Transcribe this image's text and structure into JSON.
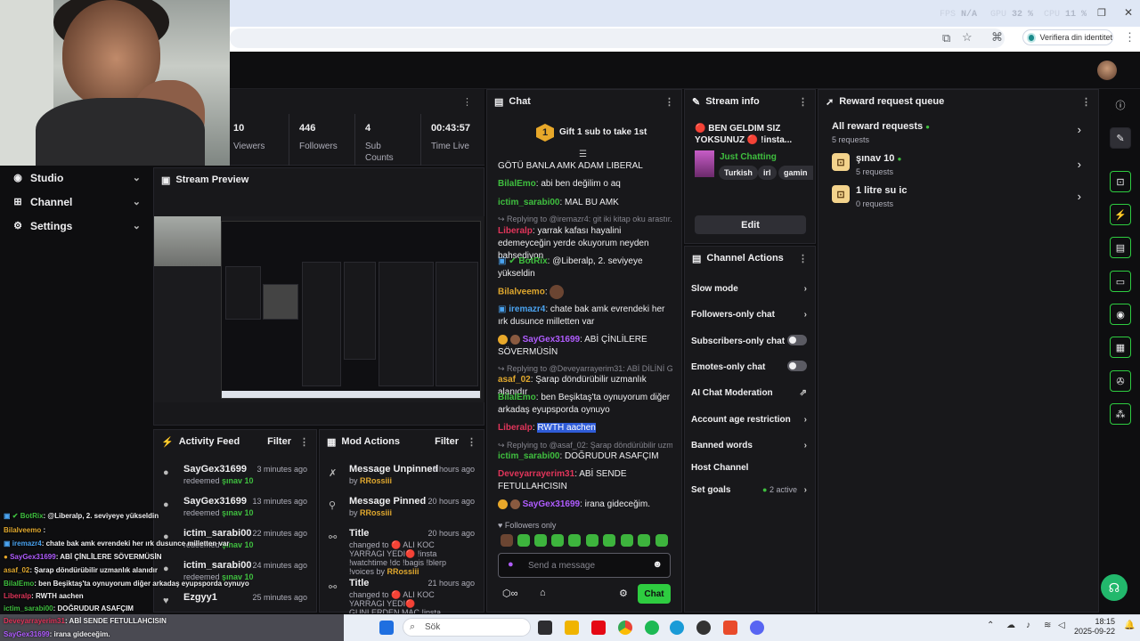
{
  "browser": {
    "stats": [
      {
        "k": "FPS",
        "v": "N/A"
      },
      {
        "k": "GPU",
        "v": "32 %"
      },
      {
        "k": "CPU",
        "v": "11 %"
      }
    ],
    "verify_label": "Verifiera din identitet"
  },
  "nav": {
    "items": [
      {
        "label": "Studio"
      },
      {
        "label": "Channel"
      },
      {
        "label": "Settings"
      }
    ]
  },
  "stats": [
    {
      "value": "10",
      "label": "Viewers"
    },
    {
      "value": "446",
      "label": "Followers"
    },
    {
      "value": "4",
      "label": "Sub Counts"
    },
    {
      "value": "00:43:57",
      "label": "Time Live"
    }
  ],
  "preview": {
    "title": "Stream Preview"
  },
  "activity": {
    "title": "Activity Feed",
    "filter": "Filter",
    "rows": [
      {
        "name": "SayGex31699",
        "prefix": "redeemed ",
        "reward": "şınav 10",
        "time": "3 minutes ago"
      },
      {
        "name": "SayGex31699",
        "prefix": "redeemed ",
        "reward": "şınav 10",
        "time": "13 minutes ago"
      },
      {
        "name": "ictim_sarabi00",
        "prefix": "redeemed ",
        "reward": "şınav 10",
        "time": "22 minutes ago"
      },
      {
        "name": "ictim_sarabi00",
        "prefix": "redeemed ",
        "reward": "şınav 10",
        "time": "24 minutes ago"
      },
      {
        "name": "Ezgyy1",
        "prefix": "",
        "reward": "",
        "time": "25 minutes ago"
      }
    ]
  },
  "mod": {
    "title": "Mod Actions",
    "filter": "Filter",
    "rows": [
      {
        "title": "Message Unpinned",
        "sub": "by ",
        "by": "RRossiii",
        "time": "8 hours ago"
      },
      {
        "title": "Message Pinned",
        "sub": "by ",
        "by": "RRossiii",
        "time": "20 hours ago"
      },
      {
        "title": "Title",
        "sub": "changed to 🔴 ALI KOC YARRAGI YEDI🔴 !insta !watchtime !dc !bagis !blerp !voices by ",
        "by": "RRossiii",
        "time": "20 hours ago"
      },
      {
        "title": "Title",
        "sub": "changed to 🔴 ALI KOC YARRAGI YEDI🔴 GUNLERDEN MAC !insta",
        "by": "",
        "time": "21 hours ago"
      }
    ]
  },
  "chat": {
    "title": "Chat",
    "gift_badge": "1",
    "gift": "Gift 1 sub to take 1st",
    "messages": [
      {
        "user": "",
        "text": "GÖTÜ BANLA AMK ADAM LIBERAL",
        "color": "#efeff1"
      },
      {
        "user": "BilalEmo",
        "text": ": abi ben değilim o aq",
        "color": "#3fbf3f"
      },
      {
        "user": "ictim_sarabi00",
        "text": ": MAL BU AMK",
        "color": "#3fbf3f"
      },
      {
        "reply": "Replying to @iremazr4: git iki kitap oku arastır..."
      },
      {
        "user": "Liberalp",
        "text": ": yarrak kafası hayalini edemeyceğin yerde okuyorum neyden bahsediyon",
        "color": "#e0355a"
      },
      {
        "user": "BotRix",
        "text": ": @Liberalp, 2. seviyeye yükseldin",
        "color": "#3fbf3f"
      },
      {
        "user": "Bilalveemo",
        "text": ":",
        "color": "#e0a82e"
      },
      {
        "user": "iremazr4",
        "text": ": chate bak amk evrendeki her ırk dusunce milletten var",
        "color": "#4aa3f0"
      },
      {
        "user": "SayGex31699",
        "text": ": ABİ ÇİNLİLERE SÖVERMÜSİN",
        "color": "#b05cff"
      },
      {
        "reply": "Replying to @Deveyarrayerim31: ABİ DİLİNİ GÖ..."
      },
      {
        "user": "asaf_02",
        "text": ": Şarap döndürübilir uzmanlık alanıdır",
        "color": "#e0a82e"
      },
      {
        "user": "BilalEmo",
        "text": ": ben Beşiktaş'ta oynuyorum diğer arkadaş eyupsporda oynuyo",
        "color": "#3fbf3f"
      },
      {
        "user": "Liberalp",
        "text": ": ",
        "highlight": "RWTH aachen",
        "color": "#e0355a"
      },
      {
        "reply": "Replying to @asaf_02: Şarap döndürübilir uzma..."
      },
      {
        "user": "ictim_sarabi00",
        "text": ": DOĞRUDUR ASAFÇIM",
        "color": "#3fbf3f"
      },
      {
        "user": "Deveyarrayerim31",
        "text": ": ABİ SENDE FETULLAHCISIN",
        "color": "#e0355a"
      },
      {
        "user": "SayGex31699",
        "text": ": irana gideceğim.",
        "color": "#b05cff"
      }
    ],
    "followers_only": "Followers only",
    "placeholder": "Send a message",
    "send": "Chat"
  },
  "stream_info": {
    "title": "Stream info",
    "stream_title": "🔴 BEN GELDIM SIZ YOKSUNUZ 🔴 !insta...",
    "category": "Just Chatting",
    "tags": [
      "Turkish",
      "irl",
      "gamin"
    ],
    "edit": "Edit"
  },
  "channel_actions": {
    "title": "Channel Actions",
    "rows": [
      {
        "label": "Slow mode",
        "kind": "chev"
      },
      {
        "label": "Followers-only chat",
        "kind": "chev"
      },
      {
        "label": "Subscribers-only chat",
        "kind": "toggle"
      },
      {
        "label": "Emotes-only chat",
        "kind": "toggle"
      },
      {
        "label": "AI Chat Moderation",
        "kind": "ext"
      },
      {
        "label": "Account age restriction",
        "kind": "chev"
      },
      {
        "label": "Banned words",
        "kind": "chev"
      },
      {
        "label": "Host Channel",
        "kind": "none"
      },
      {
        "label": "Set goals",
        "kind": "goals",
        "extra": "2 active"
      }
    ]
  },
  "rewards": {
    "title": "Reward request queue",
    "all_title": "All reward requests",
    "all_count": "5 requests",
    "items": [
      {
        "title": "şınav 10",
        "count": "5 requests"
      },
      {
        "title": "1 litre su ic",
        "count": "0 requests"
      }
    ]
  },
  "overlay": [
    {
      "user": "BotRix",
      "text": ": @Liberalp, 2. seviyeye yükseldin",
      "color": "#3fbf3f"
    },
    {
      "user": "Bilalveemo",
      "text": " :",
      "color": "#e0a82e"
    },
    {
      "user": "iremazr4",
      "text": ": chate bak amk evrendeki her ırk dusunce milletten var",
      "color": "#4aa3f0"
    },
    {
      "user": "SayGex31699",
      "text": ": ABİ ÇİNLİLERE SÖVERMÜSİN",
      "color": "#b05cff"
    },
    {
      "user": "asaf_02",
      "text": ": Şarap döndürübilir uzmanlık alanıdır",
      "color": "#e0a82e"
    },
    {
      "user": "BilalEmo",
      "text": ": ben Beşiktaş'ta oynuyorum diğer arkadaş eyupsporda oynuyo",
      "color": "#3fbf3f"
    },
    {
      "user": "Liberalp",
      "text": ": RWTH aachen",
      "color": "#e0355a"
    },
    {
      "user": "ictim_sarabi00",
      "text": ": DOĞRUDUR ASAFÇIM",
      "color": "#3fbf3f"
    },
    {
      "user": "Deveyarrayerim31",
      "text": ": ABİ SENDE FETULLAHCISIN",
      "color": "#e0355a"
    },
    {
      "user": "SayGex31699",
      "text": ": irana gideceğim.",
      "color": "#b05cff"
    }
  ],
  "taskbar": {
    "search": "Sök",
    "time": "18:15",
    "date": "2025-09-22"
  }
}
